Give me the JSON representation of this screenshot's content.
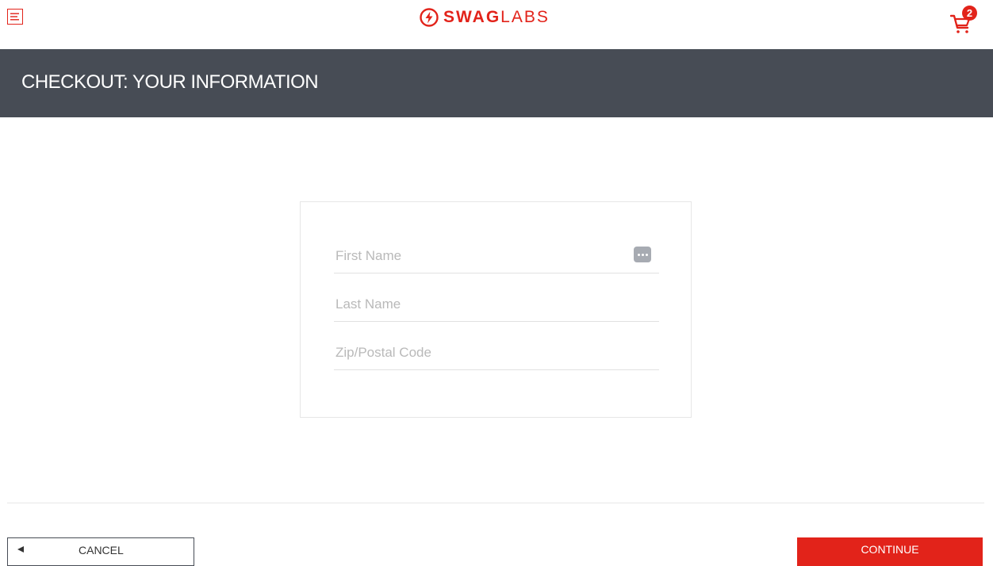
{
  "header": {
    "menu_icon": "hamburger-menu-icon",
    "logo_bold": "SWAG",
    "logo_light": "LABS",
    "cart_icon": "shopping-cart-icon",
    "cart_count": "2"
  },
  "page": {
    "title": "CHECKOUT: YOUR INFORMATION"
  },
  "form": {
    "first_name": {
      "value": "",
      "placeholder": "First Name"
    },
    "last_name": {
      "value": "",
      "placeholder": "Last Name"
    },
    "postal_code": {
      "value": "",
      "placeholder": "Zip/Postal Code"
    },
    "autofill_icon": "password-manager-icon"
  },
  "actions": {
    "cancel_label": "CANCEL",
    "cancel_icon": "back-arrow-icon",
    "continue_label": "CONTINUE"
  },
  "colors": {
    "brand_red": "#e2231a",
    "subheader_bg": "#474c55"
  }
}
